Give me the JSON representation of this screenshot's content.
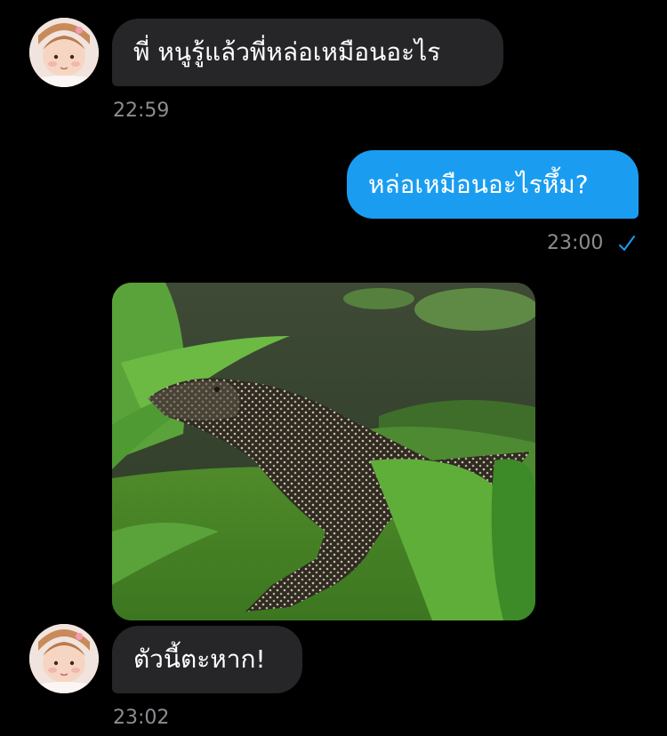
{
  "messages": [
    {
      "side": "incoming",
      "text": "พี่ หนูรู้แล้วพี่หล่อเหมือนอะไร",
      "time": "22:59"
    },
    {
      "side": "outgoing",
      "text": "หล่อเหมือนอะไรหึ้ม?",
      "time": "23:00"
    },
    {
      "side": "incoming",
      "type": "image",
      "subject": "monitor-lizard"
    },
    {
      "side": "incoming",
      "text": "ตัวนี้ตะหาก!",
      "time": "23:02"
    }
  ],
  "colors": {
    "background": "#000000",
    "incoming_bubble": "#262628",
    "outgoing_bubble": "#1a9df1",
    "timestamp": "#8b8d91",
    "read_check": "#1a9df1"
  },
  "icons": {
    "read_receipt": "check-icon"
  }
}
